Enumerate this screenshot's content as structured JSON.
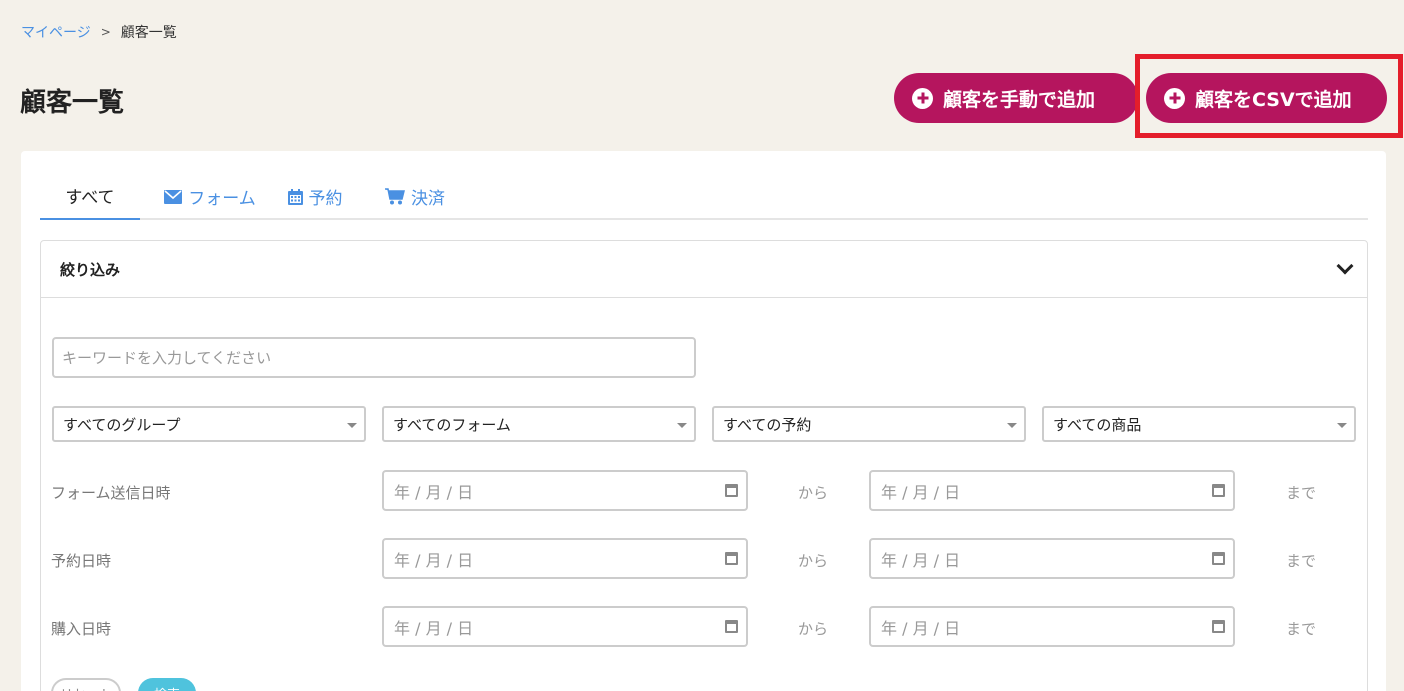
{
  "breadcrumb": {
    "home": "マイページ",
    "separator": ">",
    "current": "顧客一覧"
  },
  "page": {
    "title": "顧客一覧"
  },
  "actions": {
    "add_manual": "顧客を手動で追加",
    "add_csv": "顧客をCSVで追加"
  },
  "tabs": {
    "all": "すべて",
    "form": "フォーム",
    "reservation": "予約",
    "payment": "決済"
  },
  "filter": {
    "title": "絞り込み",
    "keyword_placeholder": "キーワードを入力してください",
    "selects": {
      "group": "すべてのグループ",
      "form": "すべてのフォーム",
      "reservation": "すべての予約",
      "product": "すべての商品"
    },
    "date_rows": {
      "form_sent": "フォーム送信日時",
      "reservation": "予約日時",
      "purchase": "購入日時"
    },
    "date_placeholder": "年 / 月 / 日",
    "from": "から",
    "until": "まで",
    "reset": "リセット",
    "search": "検索"
  },
  "colors": {
    "accent": "#b5155e",
    "link": "#4a90e2",
    "highlight": "#e41e2b",
    "search": "#4fc3dd"
  },
  "icons": {
    "add": "plus-circle-icon",
    "form": "envelope-icon",
    "reservation": "calendar-icon",
    "payment": "cart-icon",
    "collapse": "chevron-down-icon"
  }
}
